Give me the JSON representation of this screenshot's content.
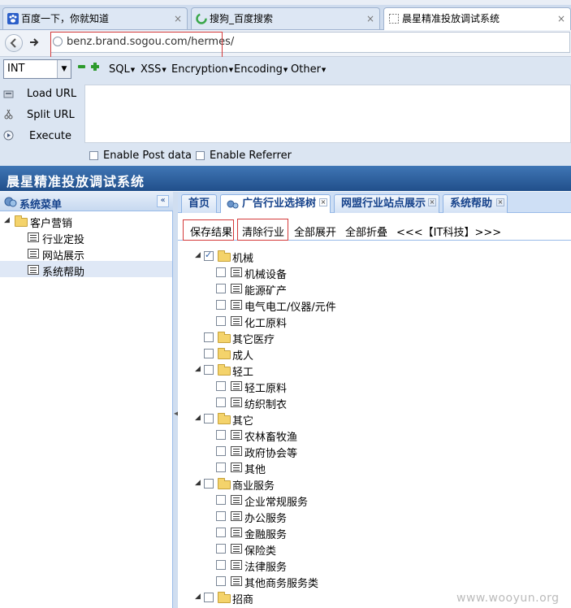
{
  "browser": {
    "tabs": [
      {
        "title": "百度一下，你就知道"
      },
      {
        "title": "搜狗_百度搜索"
      },
      {
        "title": "晨星精准投放调试系统"
      }
    ],
    "close_glyph": "×",
    "nav": {
      "back": "back-arrow-icon",
      "forward": "forward-arrow-icon"
    },
    "address": "benz.brand.sogou.com/hermes/"
  },
  "hackbar": {
    "type_select": "INT",
    "menus": [
      "SQL",
      "XSS",
      "Encryption",
      "Encoding",
      "Other"
    ],
    "actions": [
      "Load URL",
      "Split URL",
      "Execute"
    ],
    "options": [
      "Enable Post data",
      "Enable Referrer"
    ]
  },
  "app": {
    "title": "晨星精准投放调试系统",
    "sidebar": {
      "title": "系统菜单",
      "collapse_glyph": "«",
      "tree": [
        {
          "label": "客户营销"
        },
        {
          "label": "行业定投"
        },
        {
          "label": "网站展示"
        },
        {
          "label": "系统帮助"
        }
      ]
    },
    "tabs": [
      {
        "label": "首页"
      },
      {
        "label": "广告行业选择树"
      },
      {
        "label": "网盟行业站点展示"
      },
      {
        "label": "系统帮助"
      }
    ],
    "toolbar": {
      "save": "保存结果",
      "clear": "清除行业",
      "expand_all": "全部展开",
      "collapse_all": "全部折叠",
      "crumb": "<<<【IT科技】>>>"
    },
    "tree": [
      {
        "label": "机械",
        "checked": true
      },
      {
        "label": "机械设备"
      },
      {
        "label": "能源矿产"
      },
      {
        "label": "电气电工/仪器/元件"
      },
      {
        "label": "化工原料"
      },
      {
        "label": "其它医疗"
      },
      {
        "label": "成人"
      },
      {
        "label": "轻工"
      },
      {
        "label": "轻工原料"
      },
      {
        "label": "纺织制衣"
      },
      {
        "label": "其它"
      },
      {
        "label": "农林畜牧渔"
      },
      {
        "label": "政府协会等"
      },
      {
        "label": "其他"
      },
      {
        "label": "商业服务"
      },
      {
        "label": "企业常规服务"
      },
      {
        "label": "办公服务"
      },
      {
        "label": "金融服务"
      },
      {
        "label": "保险类"
      },
      {
        "label": "法律服务"
      },
      {
        "label": "其他商务服务类"
      },
      {
        "label": "招商"
      }
    ]
  },
  "watermark": "www.wooyun.org",
  "colors": {
    "header": "#2a5a98",
    "highlight_box": "#d43a3a",
    "panel_border": "#99bbe8"
  }
}
